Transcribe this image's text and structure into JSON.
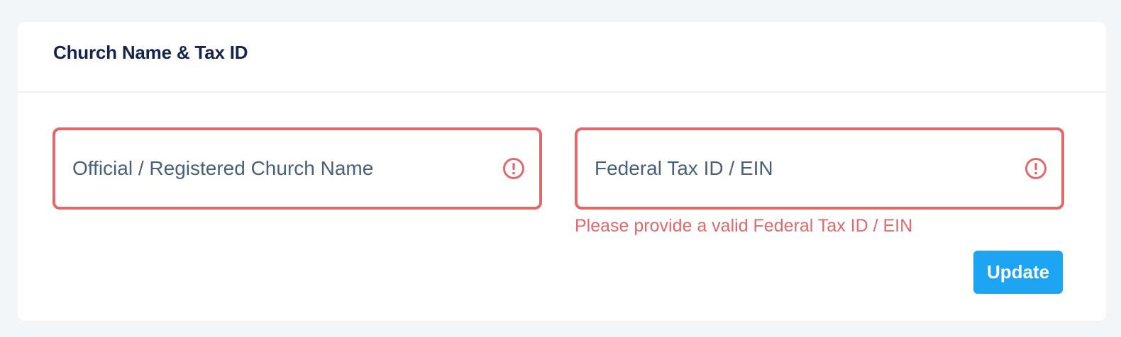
{
  "card": {
    "title": "Church Name & Tax ID"
  },
  "fields": {
    "church_name": {
      "value": "",
      "placeholder": "Official / Registered Church Name",
      "icon": "exclamation-circle-icon"
    },
    "tax_id": {
      "value": "",
      "placeholder": "Federal Tax ID / EIN",
      "icon": "exclamation-circle-icon",
      "error": "Please provide a valid Federal Tax ID / EIN"
    }
  },
  "actions": {
    "update_label": "Update"
  },
  "colors": {
    "error": "#e2686b",
    "primary": "#1da4f3",
    "title": "#14244d",
    "background": "#f3f6f9"
  }
}
